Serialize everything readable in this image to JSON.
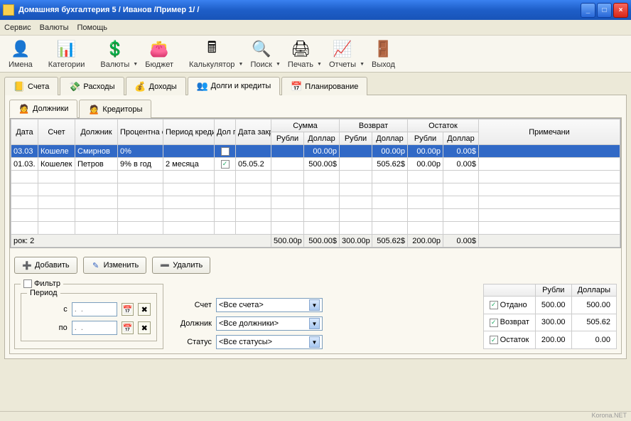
{
  "window": {
    "title": "Домашняя бухгалтерия 5  / Иванов /Пример 1/  /"
  },
  "menu": {
    "service": "Сервис",
    "currencies": "Валюты",
    "help": "Помощь"
  },
  "toolbar": {
    "names": "Имена",
    "categories": "Категории",
    "currencies": "Валюты",
    "budget": "Бюджет",
    "calculator": "Калькулятор",
    "search": "Поиск",
    "print": "Печать",
    "reports": "Отчеты",
    "exit": "Выход"
  },
  "tabs": {
    "accounts": "Счета",
    "expenses": "Расходы",
    "income": "Доходы",
    "debts": "Долги и кредиты",
    "planning": "Планирование"
  },
  "subtabs": {
    "debtors": "Должники",
    "creditors": "Кредиторы"
  },
  "grid": {
    "headers": {
      "date": "Дата",
      "account": "Счет",
      "debtor": "Должник",
      "rate": "Процентна ставка",
      "period": "Период кредитован",
      "repaid": "Дол пог.",
      "close": "Дата закрыти",
      "sum": "Сумма",
      "return": "Возврат",
      "balance": "Остаток",
      "note": "Примечани",
      "rub": "Рубли",
      "usd": "Доллар"
    },
    "rows": [
      {
        "date": "03.03",
        "account": "Кошеле",
        "debtor": "Смирнов",
        "rate": "0%",
        "period": "",
        "repaid": false,
        "close": "",
        "sum_r": "",
        "sum_d": "00.00р",
        "ret_r": "",
        "ret_d": "00.00р",
        "bal_r": "",
        "bal_d_r": "00.00р",
        "bal_d_d": "0.00$",
        "selected": true
      },
      {
        "date": "01.03.",
        "account": "Кошелек",
        "debtor": "Петров",
        "rate": "9% в год",
        "period": "2 месяца",
        "repaid": true,
        "close": "05.05.2",
        "sum_r": "",
        "sum_d": "500.00$",
        "ret_r": "",
        "ret_d": "505.62$",
        "bal_r": "",
        "bal_d_r": "00.00р",
        "bal_d_d": "0.00$",
        "selected": false
      }
    ],
    "footer": {
      "label": "рок: 2",
      "sum_r": "500.00р",
      "sum_d": "500.00$",
      "ret_r": "300.00р",
      "ret_d": "505.62$",
      "bal_r": "200.00р",
      "bal_d": "0.00$"
    }
  },
  "actions": {
    "add": "Добавить",
    "edit": "Изменить",
    "del": "Удалить"
  },
  "filter": {
    "title": "Фильтр",
    "period": "Период",
    "from": "с",
    "to": "по",
    "date_ph": ".  .",
    "account": "Счет",
    "account_val": "<Все счета>",
    "debtor": "Должник",
    "debtor_val": "<Все должники>",
    "status": "Статус",
    "status_val": "<Все статусы>"
  },
  "summary": {
    "rub": "Рубли",
    "usd": "Доллары",
    "rows": [
      {
        "label": "Отдано",
        "rub": "500.00",
        "usd": "500.00"
      },
      {
        "label": "Возврат",
        "rub": "300.00",
        "usd": "505.62"
      },
      {
        "label": "Остаток",
        "rub": "200.00",
        "usd": "0.00"
      }
    ]
  },
  "watermark": "Korona.NET"
}
